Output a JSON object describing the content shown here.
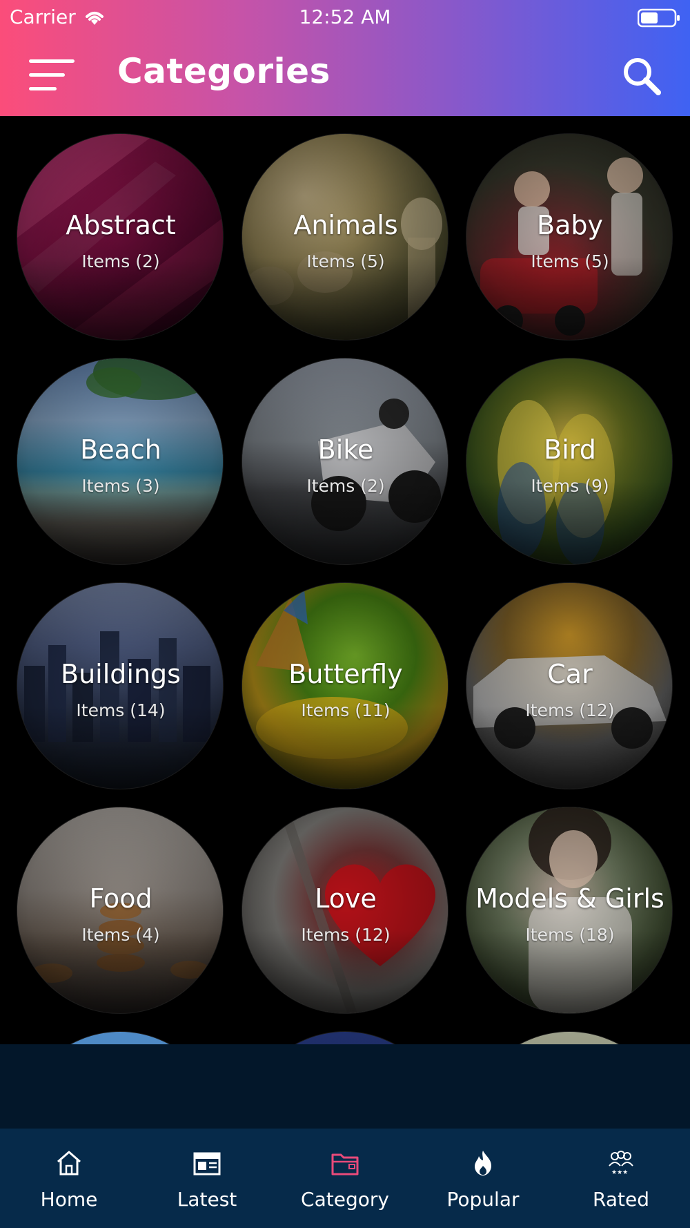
{
  "status_bar": {
    "carrier": "Carrier",
    "time": "12:52 AM"
  },
  "header": {
    "title": "Categories",
    "menu_icon": "hamburger-menu-icon",
    "search_icon": "search-icon"
  },
  "categories": [
    {
      "name": "Abstract",
      "count": "Items (2)"
    },
    {
      "name": "Animals",
      "count": "Items (5)"
    },
    {
      "name": "Baby",
      "count": "Items (5)"
    },
    {
      "name": "Beach",
      "count": "Items (3)"
    },
    {
      "name": "Bike",
      "count": "Items (2)"
    },
    {
      "name": "Bird",
      "count": "Items (9)"
    },
    {
      "name": "Buildings",
      "count": "Items (14)"
    },
    {
      "name": "Butterfly",
      "count": "Items (11)"
    },
    {
      "name": "Car",
      "count": "Items (12)"
    },
    {
      "name": "Food",
      "count": "Items (4)"
    },
    {
      "name": "Love",
      "count": "Items (12)"
    },
    {
      "name": "Models & Girls",
      "count": "Items (18)"
    }
  ],
  "tabbar": {
    "items": [
      {
        "label": "Home",
        "icon": "home-icon"
      },
      {
        "label": "Latest",
        "icon": "calendar-icon"
      },
      {
        "label": "Category",
        "icon": "folder-icon",
        "active": true
      },
      {
        "label": "Popular",
        "icon": "fire-icon"
      },
      {
        "label": "Rated",
        "icon": "rated-group-icon"
      }
    ],
    "active_color": "#e84a7a",
    "inactive_color": "#ffffff"
  },
  "colors": {
    "header_start": "#fb4d7a",
    "header_end": "#3f62f3",
    "tabbar_bg": "#062a4a",
    "ad_bg": "#03172a"
  }
}
